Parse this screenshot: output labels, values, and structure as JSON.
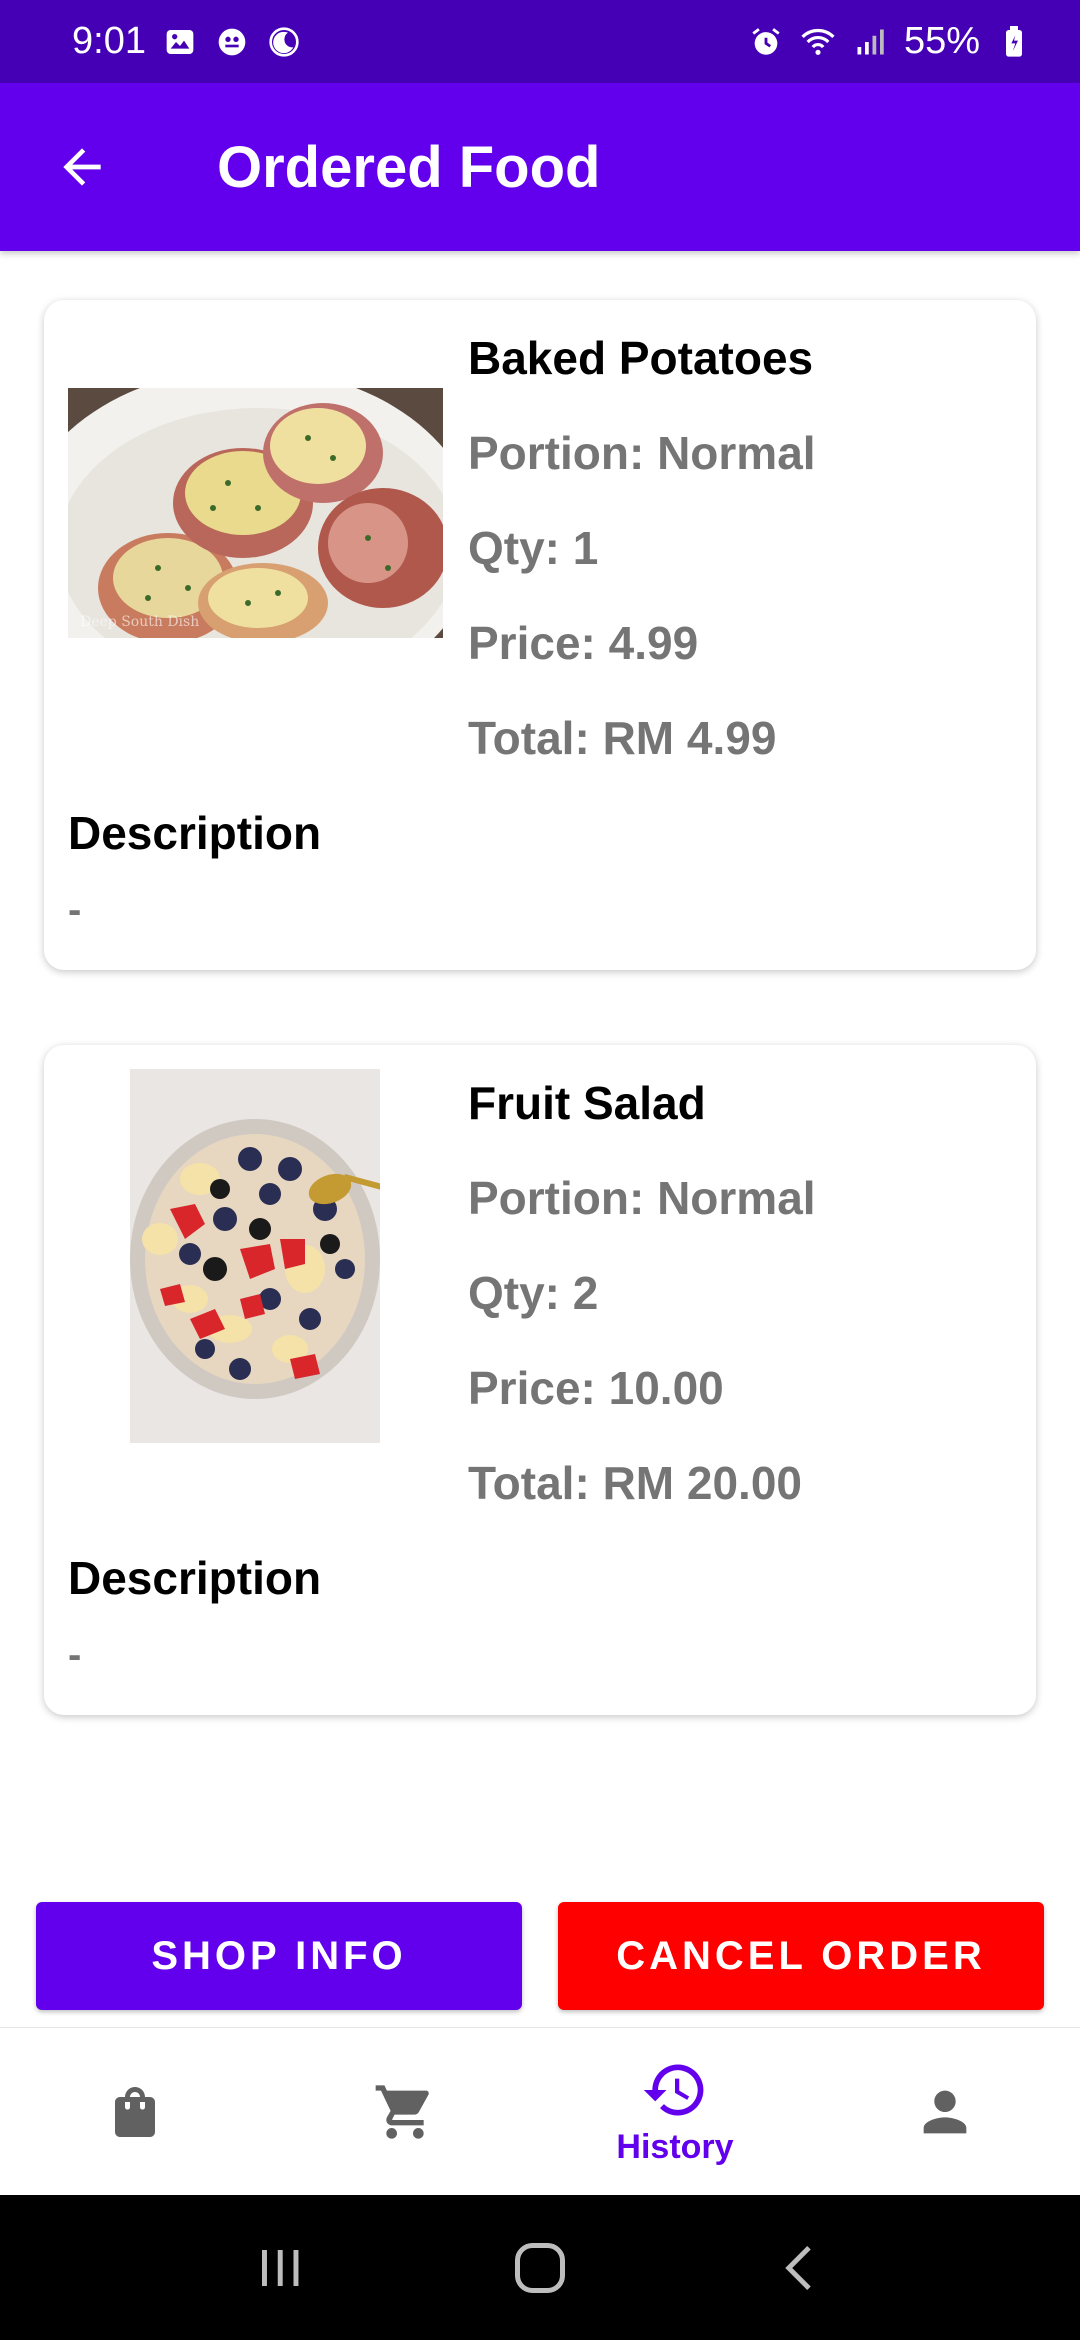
{
  "status_bar": {
    "time": "9:01",
    "battery": "55%",
    "left_icons": [
      "gallery-icon",
      "notification-icon",
      "moon-icon"
    ],
    "right_icons": [
      "alarm-icon",
      "wifi-icon",
      "signal-icon",
      "battery-icon"
    ]
  },
  "app_bar": {
    "title": "Ordered Food",
    "back_icon": "arrow-left-icon",
    "color": "#6200ee"
  },
  "orders": [
    {
      "name": "Baked Potatoes",
      "portion": "Portion: Normal",
      "qty": "Qty: 1",
      "price": "Price: 4.99",
      "total": "Total: RM 4.99",
      "description_label": "Description",
      "description": "-",
      "image": "baked-potatoes-photo",
      "image_watermark": "Deep South Dish"
    },
    {
      "name": "Fruit Salad",
      "portion": "Portion: Normal",
      "qty": "Qty: 2",
      "price": "Price: 10.00",
      "total": "Total: RM 20.00",
      "description_label": "Description",
      "description": "-",
      "image": "fruit-salad-photo"
    }
  ],
  "actions": {
    "shop_info": "SHOP INFO",
    "cancel_order": "CANCEL ORDER",
    "shop_info_color": "#6200ee",
    "cancel_color": "#ff0000"
  },
  "bottom_nav": {
    "items": [
      {
        "icon": "shopping-bag-icon",
        "label": "",
        "active": false
      },
      {
        "icon": "cart-icon",
        "label": "",
        "active": false
      },
      {
        "icon": "history-icon",
        "label": "History",
        "active": true
      },
      {
        "icon": "person-icon",
        "label": "",
        "active": false
      }
    ],
    "active_color": "#6200ee",
    "inactive_color": "#616161"
  },
  "system_nav": {
    "buttons": [
      "recents-icon",
      "home-icon",
      "back-icon"
    ]
  }
}
